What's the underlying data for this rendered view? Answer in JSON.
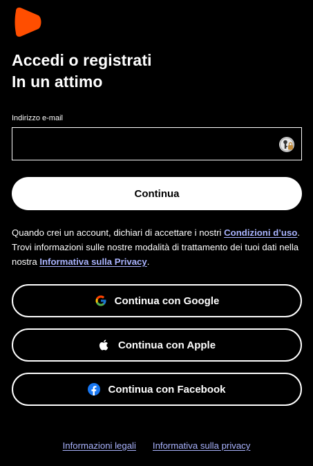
{
  "brand": {
    "logo_icon": "zalando-logo-icon",
    "accent_color": "#ff4e00"
  },
  "header": {
    "title_line1": "Accedi o registrati",
    "title_line2": "In un attimo"
  },
  "form": {
    "email_label": "Indirizzo e-mail",
    "email_value": "",
    "password_manager_icon": "password-manager-icon",
    "continue_label": "Continua"
  },
  "legal": {
    "text_before": "Quando crei un account, dichiari di accettare i nostri ",
    "terms_link": "Condizioni d’uso",
    "text_middle": ". Trovi informazioni sulle nostre modalità di trattamento dei tuoi dati nella nostra ",
    "privacy_link": "Informativa sulla Privacy",
    "text_after": "."
  },
  "social": {
    "google_label": "Continua con Google",
    "google_icon": "google-icon",
    "apple_label": "Continua con Apple",
    "apple_icon": "apple-icon",
    "facebook_label": "Continua con Facebook",
    "facebook_icon": "facebook-icon"
  },
  "footer": {
    "legal_info": "Informazioni legali",
    "privacy_policy": "Informativa sulla privacy"
  },
  "colors": {
    "background": "#000000",
    "link": "#aab4ff",
    "facebook_blue": "#1877f2"
  }
}
